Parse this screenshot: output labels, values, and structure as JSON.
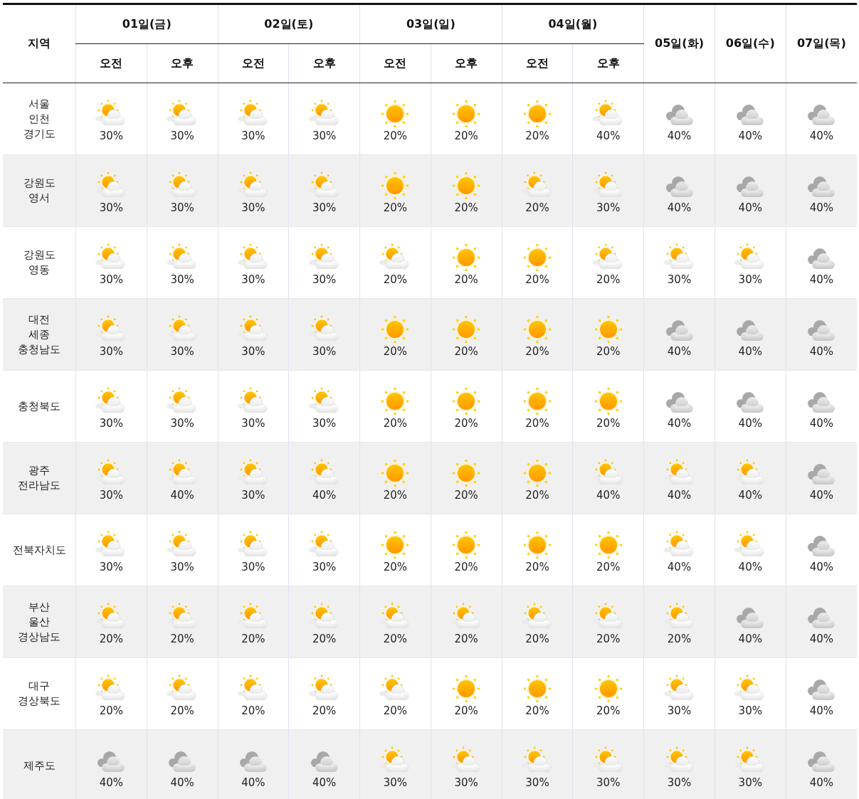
{
  "table": {
    "region_heading": "지역",
    "days": [
      {
        "label": "01일(금)",
        "periods": [
          "오전",
          "오후"
        ]
      },
      {
        "label": "02일(토)",
        "periods": [
          "오전",
          "오후"
        ]
      },
      {
        "label": "03일(일)",
        "periods": [
          "오전",
          "오후"
        ]
      },
      {
        "label": "04일(월)",
        "periods": [
          "오전",
          "오후"
        ]
      },
      {
        "label": "05일(화)"
      },
      {
        "label": "06일(수)"
      },
      {
        "label": "07일(목)"
      }
    ],
    "rows": [
      {
        "region": [
          "서울",
          "인천",
          "경기도"
        ],
        "cells": [
          {
            "kind": "partly",
            "rain": "30%"
          },
          {
            "kind": "partly",
            "rain": "30%"
          },
          {
            "kind": "partly",
            "rain": "30%"
          },
          {
            "kind": "partly",
            "rain": "30%"
          },
          {
            "kind": "sunny",
            "rain": "20%"
          },
          {
            "kind": "sunny",
            "rain": "20%"
          },
          {
            "kind": "sunny",
            "rain": "20%"
          },
          {
            "kind": "partly",
            "rain": "40%"
          },
          {
            "kind": "cloudy",
            "rain": "40%"
          },
          {
            "kind": "cloudy",
            "rain": "40%"
          },
          {
            "kind": "cloudy",
            "rain": "40%"
          }
        ]
      },
      {
        "region": [
          "강원도",
          "영서"
        ],
        "cells": [
          {
            "kind": "partly",
            "rain": "30%"
          },
          {
            "kind": "partly",
            "rain": "30%"
          },
          {
            "kind": "partly",
            "rain": "30%"
          },
          {
            "kind": "partly",
            "rain": "30%"
          },
          {
            "kind": "sunny",
            "rain": "20%"
          },
          {
            "kind": "sunny",
            "rain": "20%"
          },
          {
            "kind": "partly",
            "rain": "20%"
          },
          {
            "kind": "partly",
            "rain": "30%"
          },
          {
            "kind": "cloudy",
            "rain": "40%"
          },
          {
            "kind": "cloudy",
            "rain": "40%"
          },
          {
            "kind": "cloudy",
            "rain": "40%"
          }
        ]
      },
      {
        "region": [
          "강원도",
          "영동"
        ],
        "cells": [
          {
            "kind": "partly",
            "rain": "30%"
          },
          {
            "kind": "partly",
            "rain": "30%"
          },
          {
            "kind": "partly",
            "rain": "30%"
          },
          {
            "kind": "partly",
            "rain": "30%"
          },
          {
            "kind": "partly",
            "rain": "20%"
          },
          {
            "kind": "sunny",
            "rain": "20%"
          },
          {
            "kind": "sunny",
            "rain": "20%"
          },
          {
            "kind": "partly",
            "rain": "20%"
          },
          {
            "kind": "partly",
            "rain": "30%"
          },
          {
            "kind": "partly",
            "rain": "30%"
          },
          {
            "kind": "cloudy",
            "rain": "40%"
          }
        ]
      },
      {
        "region": [
          "대전",
          "세종",
          "충청남도"
        ],
        "cells": [
          {
            "kind": "partly",
            "rain": "30%"
          },
          {
            "kind": "partly",
            "rain": "30%"
          },
          {
            "kind": "partly",
            "rain": "30%"
          },
          {
            "kind": "partly",
            "rain": "30%"
          },
          {
            "kind": "sunny",
            "rain": "20%"
          },
          {
            "kind": "sunny",
            "rain": "20%"
          },
          {
            "kind": "sunny",
            "rain": "20%"
          },
          {
            "kind": "sunny",
            "rain": "20%"
          },
          {
            "kind": "cloudy",
            "rain": "40%"
          },
          {
            "kind": "cloudy",
            "rain": "40%"
          },
          {
            "kind": "cloudy",
            "rain": "40%"
          }
        ]
      },
      {
        "region": [
          "충청북도"
        ],
        "cells": [
          {
            "kind": "partly",
            "rain": "30%"
          },
          {
            "kind": "partly",
            "rain": "30%"
          },
          {
            "kind": "partly",
            "rain": "30%"
          },
          {
            "kind": "partly",
            "rain": "30%"
          },
          {
            "kind": "sunny",
            "rain": "20%"
          },
          {
            "kind": "sunny",
            "rain": "20%"
          },
          {
            "kind": "sunny",
            "rain": "20%"
          },
          {
            "kind": "sunny",
            "rain": "20%"
          },
          {
            "kind": "cloudy",
            "rain": "40%"
          },
          {
            "kind": "cloudy",
            "rain": "40%"
          },
          {
            "kind": "cloudy",
            "rain": "40%"
          }
        ]
      },
      {
        "region": [
          "광주",
          "전라남도"
        ],
        "cells": [
          {
            "kind": "partly",
            "rain": "30%"
          },
          {
            "kind": "partly",
            "rain": "40%"
          },
          {
            "kind": "partly",
            "rain": "30%"
          },
          {
            "kind": "partly",
            "rain": "40%"
          },
          {
            "kind": "sunny",
            "rain": "20%"
          },
          {
            "kind": "sunny",
            "rain": "20%"
          },
          {
            "kind": "sunny",
            "rain": "20%"
          },
          {
            "kind": "partly",
            "rain": "40%"
          },
          {
            "kind": "partly",
            "rain": "40%"
          },
          {
            "kind": "partly",
            "rain": "40%"
          },
          {
            "kind": "cloudy",
            "rain": "40%"
          }
        ]
      },
      {
        "region": [
          "전북자치도"
        ],
        "cells": [
          {
            "kind": "partly",
            "rain": "30%"
          },
          {
            "kind": "partly",
            "rain": "30%"
          },
          {
            "kind": "partly",
            "rain": "30%"
          },
          {
            "kind": "partly",
            "rain": "30%"
          },
          {
            "kind": "sunny",
            "rain": "20%"
          },
          {
            "kind": "sunny",
            "rain": "20%"
          },
          {
            "kind": "sunny",
            "rain": "20%"
          },
          {
            "kind": "sunny",
            "rain": "20%"
          },
          {
            "kind": "partly",
            "rain": "40%"
          },
          {
            "kind": "partly",
            "rain": "40%"
          },
          {
            "kind": "cloudy",
            "rain": "40%"
          }
        ]
      },
      {
        "region": [
          "부산",
          "울산",
          "경상남도"
        ],
        "cells": [
          {
            "kind": "partly",
            "rain": "20%"
          },
          {
            "kind": "partly",
            "rain": "20%"
          },
          {
            "kind": "partly",
            "rain": "20%"
          },
          {
            "kind": "partly",
            "rain": "20%"
          },
          {
            "kind": "partly",
            "rain": "20%"
          },
          {
            "kind": "partly",
            "rain": "20%"
          },
          {
            "kind": "partly",
            "rain": "20%"
          },
          {
            "kind": "partly",
            "rain": "20%"
          },
          {
            "kind": "partly",
            "rain": "20%"
          },
          {
            "kind": "cloudy",
            "rain": "40%"
          },
          {
            "kind": "cloudy",
            "rain": "40%"
          }
        ]
      },
      {
        "region": [
          "대구",
          "경상북도"
        ],
        "cells": [
          {
            "kind": "partly",
            "rain": "20%"
          },
          {
            "kind": "partly",
            "rain": "20%"
          },
          {
            "kind": "partly",
            "rain": "20%"
          },
          {
            "kind": "partly",
            "rain": "20%"
          },
          {
            "kind": "partly",
            "rain": "20%"
          },
          {
            "kind": "sunny",
            "rain": "20%"
          },
          {
            "kind": "sunny",
            "rain": "20%"
          },
          {
            "kind": "sunny",
            "rain": "20%"
          },
          {
            "kind": "partly",
            "rain": "30%"
          },
          {
            "kind": "partly",
            "rain": "30%"
          },
          {
            "kind": "cloudy",
            "rain": "40%"
          }
        ]
      },
      {
        "region": [
          "제주도"
        ],
        "cells": [
          {
            "kind": "cloudy",
            "rain": "40%"
          },
          {
            "kind": "cloudy",
            "rain": "40%"
          },
          {
            "kind": "cloudy",
            "rain": "40%"
          },
          {
            "kind": "cloudy",
            "rain": "40%"
          },
          {
            "kind": "partly",
            "rain": "30%"
          },
          {
            "kind": "partly",
            "rain": "30%"
          },
          {
            "kind": "partly",
            "rain": "30%"
          },
          {
            "kind": "partly",
            "rain": "30%"
          },
          {
            "kind": "partly",
            "rain": "30%"
          },
          {
            "kind": "partly",
            "rain": "30%"
          },
          {
            "kind": "cloudy",
            "rain": "40%"
          }
        ]
      }
    ]
  }
}
